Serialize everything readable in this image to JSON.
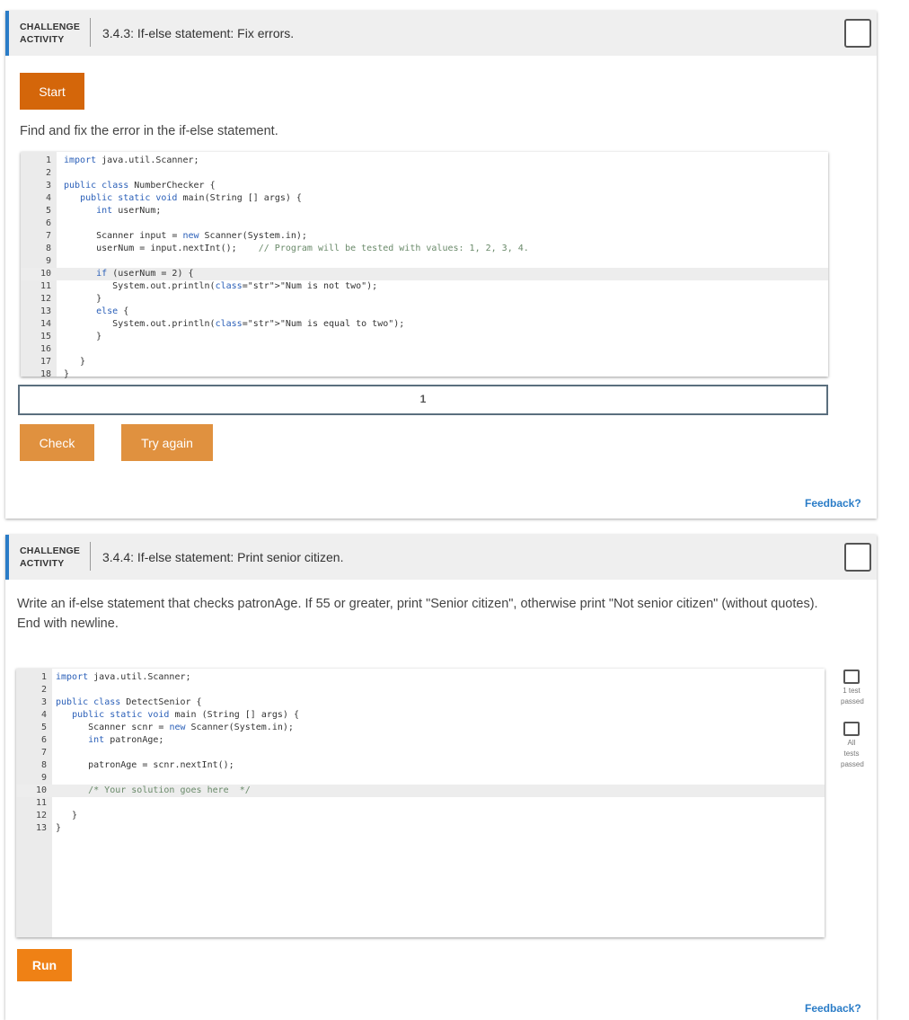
{
  "activity1": {
    "kind_line1": "CHALLENGE",
    "kind_line2": "ACTIVITY",
    "title": "3.4.3: If-else statement: Fix errors.",
    "start_label": "Start",
    "instruction": "Find and fix the error in the if-else statement.",
    "code_lines": [
      "import java.util.Scanner;",
      "",
      "public class NumberChecker {",
      "   public static void main(String [] args) {",
      "      int userNum;",
      "",
      "      Scanner input = new Scanner(System.in);",
      "      userNum = input.nextInt();    // Program will be tested with values: 1, 2, 3, 4.",
      "",
      "      if (userNum = 2) {",
      "         System.out.println(\"Num is not two\");",
      "      }",
      "      else {",
      "         System.out.println(\"Num is equal to two\");",
      "      }",
      "",
      "   }",
      "}"
    ],
    "result_label": "1",
    "check_label": "Check",
    "try_again_label": "Try again",
    "feedback_label": "Feedback?"
  },
  "activity2": {
    "kind_line1": "CHALLENGE",
    "kind_line2": "ACTIVITY",
    "title": "3.4.4: If-else statement: Print senior citizen.",
    "instruction": "Write an if-else statement that checks patronAge. If 55 or greater, print \"Senior citizen\", otherwise print \"Not senior citizen\" (without quotes). End with newline.",
    "code_lines": [
      "import java.util.Scanner;",
      "",
      "public class DetectSenior {",
      "   public static void main (String [] args) {",
      "      Scanner scnr = new Scanner(System.in);",
      "      int patronAge;",
      "",
      "      patronAge = scnr.nextInt();",
      "",
      "      /* Your solution goes here  */",
      "",
      "   }",
      "}"
    ],
    "test1_label": "1 test passed",
    "test_all_label": "All tests passed",
    "run_label": "Run",
    "feedback_label": "Feedback?"
  },
  "colors": {
    "accent_blue": "#2a7cc7",
    "start_orange": "#d4660a",
    "check_orange": "#e0913f",
    "run_orange": "#ef8115"
  }
}
